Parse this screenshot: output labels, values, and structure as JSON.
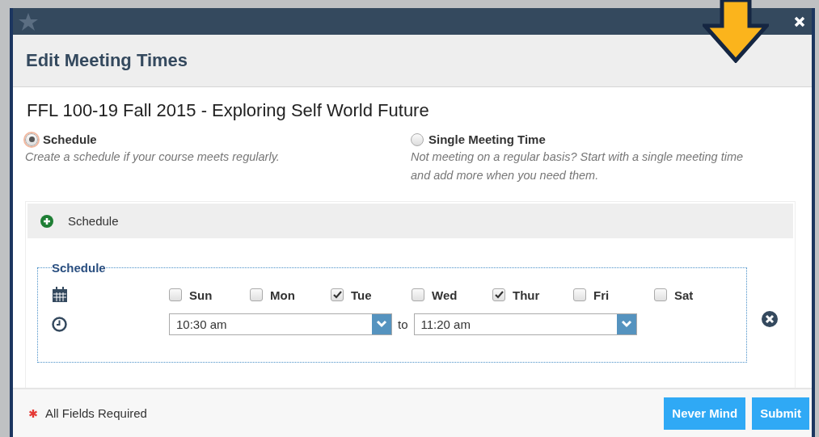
{
  "dialog": {
    "title": "Edit Meeting Times"
  },
  "course_title": "FFL 100-19 Fall 2015 - Exploring Self World Future",
  "options": [
    {
      "label": "Schedule",
      "description": "Create a schedule if your course meets regularly.",
      "selected": true
    },
    {
      "label": "Single Meeting Time",
      "description": "Not meeting on a regular basis? Start with a single meeting time and add more when you need them.",
      "selected": false
    }
  ],
  "panel": {
    "add_label": "Schedule"
  },
  "schedule": {
    "legend": "Schedule",
    "days": [
      {
        "label": "Sun",
        "checked": false
      },
      {
        "label": "Mon",
        "checked": false
      },
      {
        "label": "Tue",
        "checked": true
      },
      {
        "label": "Wed",
        "checked": false
      },
      {
        "label": "Thur",
        "checked": true
      },
      {
        "label": "Fri",
        "checked": false
      },
      {
        "label": "Sat",
        "checked": false
      }
    ],
    "start": {
      "value": "10:30 am"
    },
    "separator": "to",
    "end": {
      "value": "11:20 am"
    }
  },
  "footer": {
    "note": "All Fields Required",
    "buttons": [
      "Never Mind",
      "Submit"
    ]
  }
}
